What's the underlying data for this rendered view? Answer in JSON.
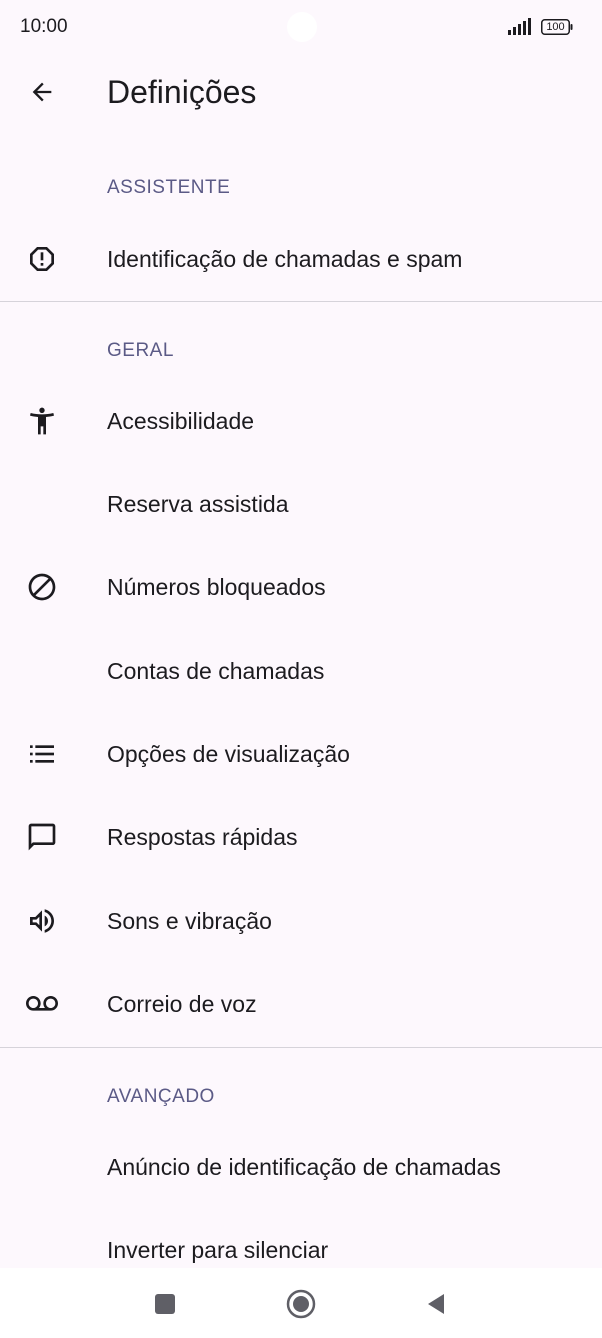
{
  "status_bar": {
    "time": "10:00",
    "battery": "100",
    "signal_icon": "cellular-signal-icon"
  },
  "app_bar": {
    "title": "Definições",
    "back_icon": "arrow-back-icon"
  },
  "sections": {
    "assistant": {
      "header": "ASSISTENTE",
      "items": [
        {
          "label": "Identificação de chamadas e spam",
          "icon": "alert-circle-icon"
        }
      ]
    },
    "general": {
      "header": "GERAL",
      "items": [
        {
          "label": "Acessibilidade",
          "icon": "accessibility-icon"
        },
        {
          "label": "Reserva assistida",
          "icon": ""
        },
        {
          "label": "Números bloqueados",
          "icon": "block-icon"
        },
        {
          "label": "Contas de chamadas",
          "icon": ""
        },
        {
          "label": "Opções de visualização",
          "icon": "list-icon"
        },
        {
          "label": "Respostas rápidas",
          "icon": "chat-bubble-icon"
        },
        {
          "label": "Sons e vibração",
          "icon": "volume-icon"
        },
        {
          "label": "Correio de voz",
          "icon": "voicemail-icon"
        }
      ]
    },
    "advanced": {
      "header": "AVANÇADO",
      "items": [
        {
          "label": "Anúncio de identificação de chamadas",
          "icon": ""
        },
        {
          "label": "Inverter para silenciar",
          "icon": ""
        }
      ]
    }
  },
  "nav_bar": {
    "recents_icon": "recents-square-icon",
    "home_icon": "home-circle-icon",
    "back_icon": "back-triangle-icon"
  },
  "colors": {
    "background": "#fdf8fd",
    "text": "#1c1b1f",
    "section_header": "#5b5a86",
    "divider": "#d6d3da"
  }
}
